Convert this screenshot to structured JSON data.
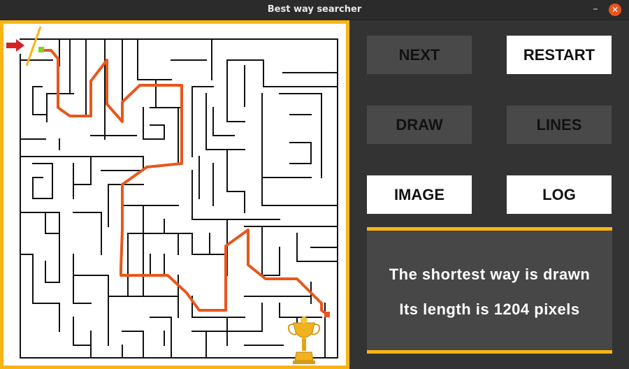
{
  "window": {
    "title": "Best way searcher",
    "minimize_label": "–",
    "close_label": "✕"
  },
  "buttons": {
    "next": "NEXT",
    "restart": "RESTART",
    "draw": "DRAW",
    "lines": "LINES",
    "image": "IMAGE",
    "log": "LOG"
  },
  "info": {
    "line1": "The shortest way is drawn",
    "line2": "Its length is 1204 pixels"
  },
  "maze": {
    "icons": [
      "red-arrow-icon",
      "start-marker-icon",
      "end-marker-icon",
      "trophy-icon"
    ],
    "colors": {
      "frame": "#f8b416",
      "path": "#e8571c",
      "arrow": "#d42222",
      "start": "#7ed321"
    }
  }
}
